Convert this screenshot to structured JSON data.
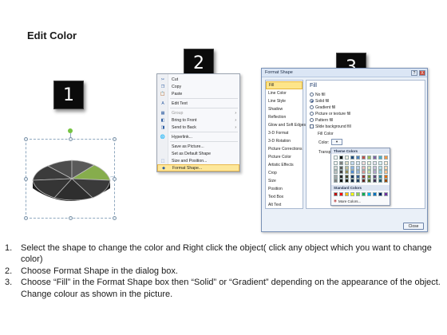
{
  "title": "Edit Color",
  "steps_badges": [
    "1",
    "2",
    "3"
  ],
  "context_menu": {
    "items": [
      {
        "label": "Cut",
        "icon": "scissors-icon"
      },
      {
        "label": "Copy",
        "icon": "copy-icon"
      },
      {
        "label": "Paste",
        "icon": "paste-icon"
      },
      {
        "label": "Edit Text",
        "icon": "edit-text-icon"
      },
      {
        "label": "Group",
        "icon": "group-icon",
        "disabled": true,
        "submenu": true
      },
      {
        "label": "Bring to Front",
        "icon": "bring-front-icon",
        "submenu": true
      },
      {
        "label": "Send to Back",
        "icon": "send-back-icon",
        "submenu": true
      },
      {
        "label": "Hyperlink...",
        "icon": "hyperlink-icon"
      },
      {
        "label": "Save as Picture...",
        "icon": ""
      },
      {
        "label": "Set as Default Shape",
        "icon": ""
      },
      {
        "label": "Size and Position...",
        "icon": "size-position-icon"
      },
      {
        "label": "Format Shape...",
        "icon": "format-shape-icon",
        "highlight": true
      }
    ]
  },
  "dialog": {
    "title": "Format Shape",
    "help": "?",
    "close_x": "X",
    "nav": [
      "Fill",
      "Line Color",
      "Line Style",
      "Shadow",
      "Reflection",
      "Glow and Soft Edges",
      "3-D Format",
      "3-D Rotation",
      "Picture Corrections",
      "Picture Color",
      "Artistic Effects",
      "Crop",
      "Size",
      "Position",
      "Text Box",
      "Alt Text"
    ],
    "panel_heading": "Fill",
    "radios": [
      {
        "label": "No fill",
        "on": false
      },
      {
        "label": "Solid fill",
        "on": true
      },
      {
        "label": "Gradient fill",
        "on": false
      },
      {
        "label": "Picture or texture fill",
        "on": false
      },
      {
        "label": "Pattern fill",
        "on": false
      }
    ],
    "slide_bg": "Slide background fill",
    "fill_color": "Fill Color",
    "color_label": "Color:",
    "transparency_label": "Transpa",
    "theme_colors": "Theme Colors",
    "standard_colors": "Standard Colors",
    "more_colors": "More Colors...",
    "close": "Close"
  },
  "palette": {
    "theme_top": [
      "#ffffff",
      "#000000",
      "#eeece1",
      "#1f497d",
      "#4f81bd",
      "#c0504d",
      "#9bbb59",
      "#8064a2",
      "#4bacc6",
      "#f79646"
    ],
    "theme_shades": [
      [
        "#f2f2f2",
        "#7f7f7f",
        "#ddd9c3",
        "#c6d9f0",
        "#dbe5f1",
        "#f2dcdb",
        "#ebf1dd",
        "#e5e0ec",
        "#dbeef3",
        "#fdeada"
      ],
      [
        "#d8d8d8",
        "#595959",
        "#c4bd97",
        "#8db3e2",
        "#b8cce4",
        "#e5b9b7",
        "#d7e3bc",
        "#ccc1d9",
        "#b7dde8",
        "#fbd5b5"
      ],
      [
        "#bfbfbf",
        "#3f3f3f",
        "#938953",
        "#548dd4",
        "#95b3d7",
        "#d99694",
        "#c3d69b",
        "#b2a2c7",
        "#92cddc",
        "#fac08f"
      ],
      [
        "#a5a5a5",
        "#262626",
        "#494429",
        "#17365d",
        "#366092",
        "#953734",
        "#76923c",
        "#5f497a",
        "#31859b",
        "#e36c09"
      ],
      [
        "#7f7f7f",
        "#0c0c0c",
        "#1d1b10",
        "#0f243e",
        "#244061",
        "#632423",
        "#4f6128",
        "#3f3151",
        "#205867",
        "#974806"
      ]
    ],
    "standard": [
      "#c00000",
      "#ff0000",
      "#ffc000",
      "#ffff00",
      "#92d050",
      "#00b050",
      "#00b0f0",
      "#0070c0",
      "#002060",
      "#7030a0"
    ]
  },
  "instructions": [
    {
      "num": "1.",
      "text": "Select the shape to change the color and Right click the object( click any object which you want to change color)"
    },
    {
      "num": "2.",
      "text": "Choose Format Shape in the dialog box."
    },
    {
      "num": "3.",
      "text": "Choose “Fill” in the Format Shape box then “Solid” or “Gradient” depending on the appearance of the object. Change colour as shown in the picture."
    }
  ]
}
